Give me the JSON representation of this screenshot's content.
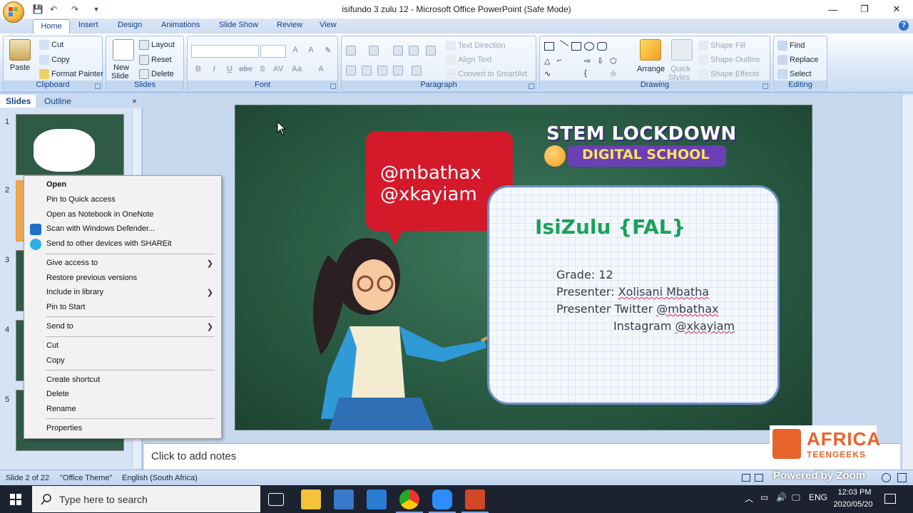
{
  "window": {
    "title": "isifundo 3 zulu 12 - Microsoft Office PowerPoint (Safe Mode)",
    "minimize": "—",
    "restore": "❐",
    "close": "✕"
  },
  "quick_access": {
    "save_icon": "save-icon",
    "undo_icon": "undo-icon",
    "redo_icon": "redo-icon"
  },
  "ribbon_tabs": [
    "Home",
    "Insert",
    "Design",
    "Animations",
    "Slide Show",
    "Review",
    "View"
  ],
  "ribbon": {
    "clipboard": {
      "label": "Clipboard",
      "paste": "Paste",
      "cut": "Cut",
      "copy": "Copy",
      "format_painter": "Format Painter"
    },
    "slides": {
      "label": "Slides",
      "new_slide_line1": "New",
      "new_slide_line2": "Slide",
      "layout": "Layout",
      "reset": "Reset",
      "delete": "Delete"
    },
    "font": {
      "label": "Font"
    },
    "paragraph": {
      "label": "Paragraph",
      "text_direction": "Text Direction",
      "align_text": "Align Text",
      "convert_smartart": "Convert to SmartArt"
    },
    "drawing": {
      "label": "Drawing",
      "arrange": "Arrange",
      "quick_styles_line1": "Quick",
      "quick_styles_line2": "Styles",
      "shape_fill": "Shape Fill",
      "shape_outline": "Shape Outline",
      "shape_effects": "Shape Effects"
    },
    "editing": {
      "label": "Editing",
      "find": "Find",
      "replace": "Replace",
      "select": "Select"
    }
  },
  "slides_pane": {
    "tab_slides": "Slides",
    "tab_outline": "Outline",
    "close": "×",
    "slide_numbers": [
      "1",
      "2",
      "3",
      "4",
      "5"
    ]
  },
  "slide": {
    "stem_title": "STEM LOCKDOWN",
    "stem_subtitle": "DIGITAL SCHOOL",
    "bubble_line1": "@mbathax",
    "bubble_line2": "@xkayiam",
    "card_title": "IsiZulu {FAL}",
    "grade": "Grade: 12",
    "presenter_label": "Presenter: ",
    "presenter_name": "Xolisani Mbatha",
    "twitter_label": "Presenter Twitter ",
    "twitter_handle": "@mbathax",
    "instagram_label": "Instagram ",
    "instagram_handle": "@xkayiam"
  },
  "notes": {
    "placeholder": "Click to add notes"
  },
  "status_bar": {
    "slide_info": "Slide 2 of 22",
    "theme": "\"Office Theme\"",
    "language": "English (South Africa)"
  },
  "watermarks": {
    "atg_line1": "AFRICA",
    "atg_line2": "TEENGEEKS",
    "zoom": "Powered by Zoom"
  },
  "context_menu": {
    "open": "Open",
    "pin_quick_access": "Pin to Quick access",
    "open_onenote": "Open as Notebook in OneNote",
    "scan_defender": "Scan with Windows Defender...",
    "send_shareit": "Send to other devices with SHAREit",
    "give_access": "Give access to",
    "restore_versions": "Restore previous versions",
    "include_library": "Include in library",
    "pin_start": "Pin to Start",
    "send_to": "Send to",
    "cut": "Cut",
    "copy": "Copy",
    "create_shortcut": "Create shortcut",
    "delete": "Delete",
    "rename": "Rename",
    "properties": "Properties"
  },
  "taskbar": {
    "search_placeholder": "Type here to search",
    "language": "ENG",
    "time": "12:03 PM",
    "date": "2020/05/20"
  },
  "colors": {
    "accent": "#15428b",
    "slide_green": "#27563f",
    "bubble_red": "#d4192b",
    "card_title_green": "#1ca05a",
    "atg_orange": "#e8632b"
  }
}
